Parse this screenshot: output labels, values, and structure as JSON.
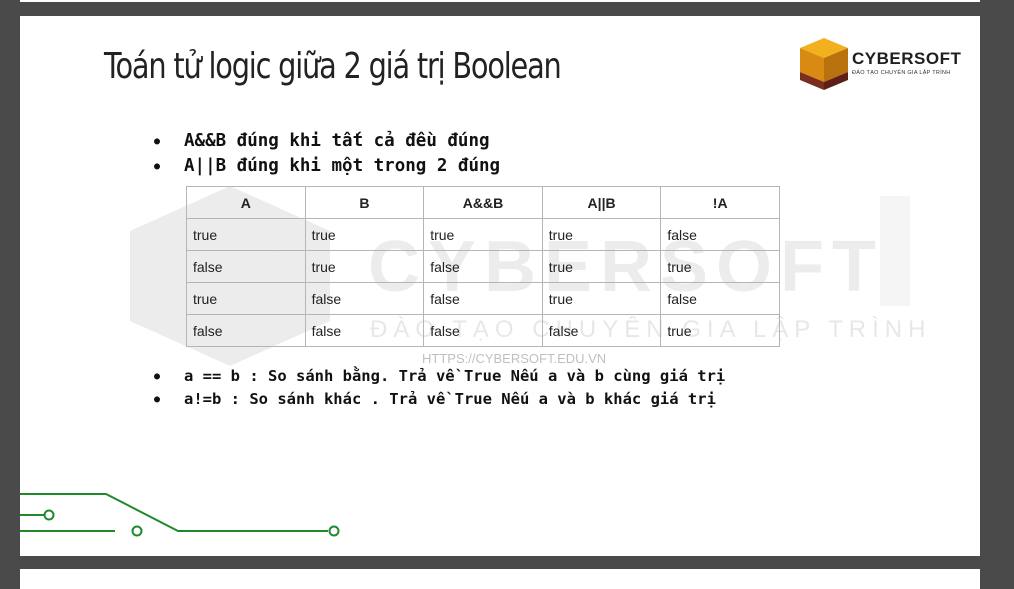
{
  "slide": {
    "title": "Toán tử logic giữa 2 giá trị Boolean",
    "logo": {
      "name": "CYBERSOFT",
      "tagline": "ĐÀO TẠO CHUYÊN GIA LẬP TRÌNH"
    },
    "bullets_top": [
      "A&&B đúng khi tất cả đều đúng",
      "A||B đúng khi một trong 2 đúng"
    ],
    "truth_table": {
      "headers": [
        "A",
        "B",
        "A&&B",
        "A||B",
        "!A"
      ],
      "rows": [
        [
          "true",
          "true",
          "true",
          "true",
          "false"
        ],
        [
          "false",
          "true",
          "false",
          "true",
          "true"
        ],
        [
          "true",
          "false",
          "false",
          "true",
          "false"
        ],
        [
          "false",
          "false",
          "false",
          "false",
          "true"
        ]
      ]
    },
    "bullets_bottom": [
      "a == b : So sánh bằng. Trả về True Nếu a và b cùng giá trị",
      "a!=b : So sánh khác . Trả về True Nếu a và b khác giá trị"
    ],
    "watermark": {
      "word": "CYBERSOFT",
      "subtitle": "ĐÀO TẠO CHUYÊN GIA LẬP TRÌNH",
      "url": "HTTPS://CYBERSOFT.EDU.VN"
    },
    "colors": {
      "background": "#4a4a4a",
      "slide": "#ffffff",
      "circuit": "#1e8a2c",
      "logo_gold": "#e8a317",
      "logo_brown": "#7a2e1e"
    }
  }
}
